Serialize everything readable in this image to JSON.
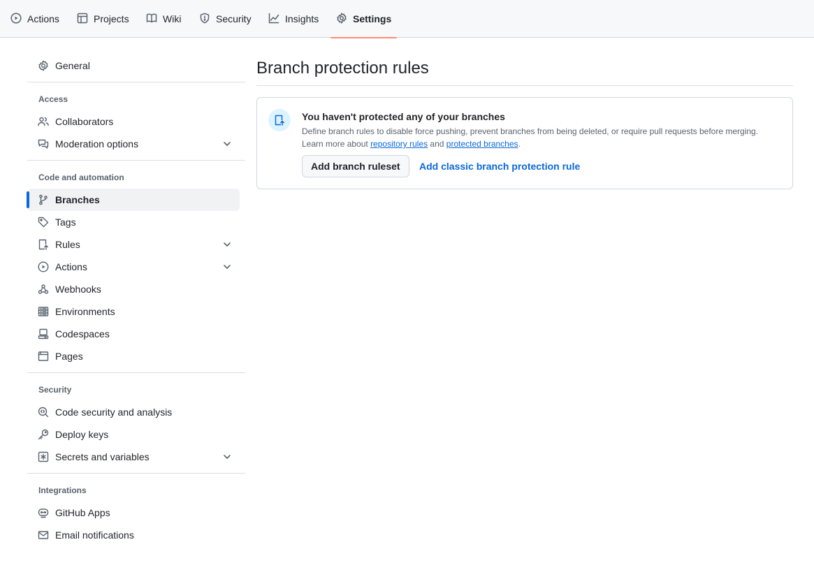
{
  "topnav": {
    "tabs": [
      {
        "label": "Actions",
        "icon": "play-icon"
      },
      {
        "label": "Projects",
        "icon": "table-icon"
      },
      {
        "label": "Wiki",
        "icon": "book-icon"
      },
      {
        "label": "Security",
        "icon": "shield-icon"
      },
      {
        "label": "Insights",
        "icon": "graph-icon"
      },
      {
        "label": "Settings",
        "icon": "gear-icon",
        "active": true
      }
    ]
  },
  "sidebar": {
    "general": "General",
    "groups": {
      "access": "Access",
      "code_automation": "Code and automation",
      "security": "Security",
      "integrations": "Integrations"
    },
    "items": {
      "collaborators": "Collaborators",
      "moderation": "Moderation options",
      "branches": "Branches",
      "tags": "Tags",
      "rules": "Rules",
      "actions": "Actions",
      "webhooks": "Webhooks",
      "environments": "Environments",
      "codespaces": "Codespaces",
      "pages": "Pages",
      "code_security": "Code security and analysis",
      "deploy_keys": "Deploy keys",
      "secrets": "Secrets and variables",
      "github_apps": "GitHub Apps",
      "email": "Email notifications"
    },
    "active_item": "Branches"
  },
  "main": {
    "title": "Branch protection rules",
    "blankslate": {
      "heading": "You haven't protected any of your branches",
      "desc_line1": "Define branch rules to disable force pushing, prevent branches from being deleted, or require pull requests before merging.",
      "learn_prefix": "Learn more about ",
      "link_repo_rules": "repository rules",
      "and": " and ",
      "link_protected": "protected branches",
      "period": ".",
      "primary_button": "Add branch ruleset",
      "secondary_link": "Add classic branch protection rule"
    }
  },
  "colors": {
    "accent": "#0969da",
    "active_tab_underline": "#fd8c73"
  }
}
